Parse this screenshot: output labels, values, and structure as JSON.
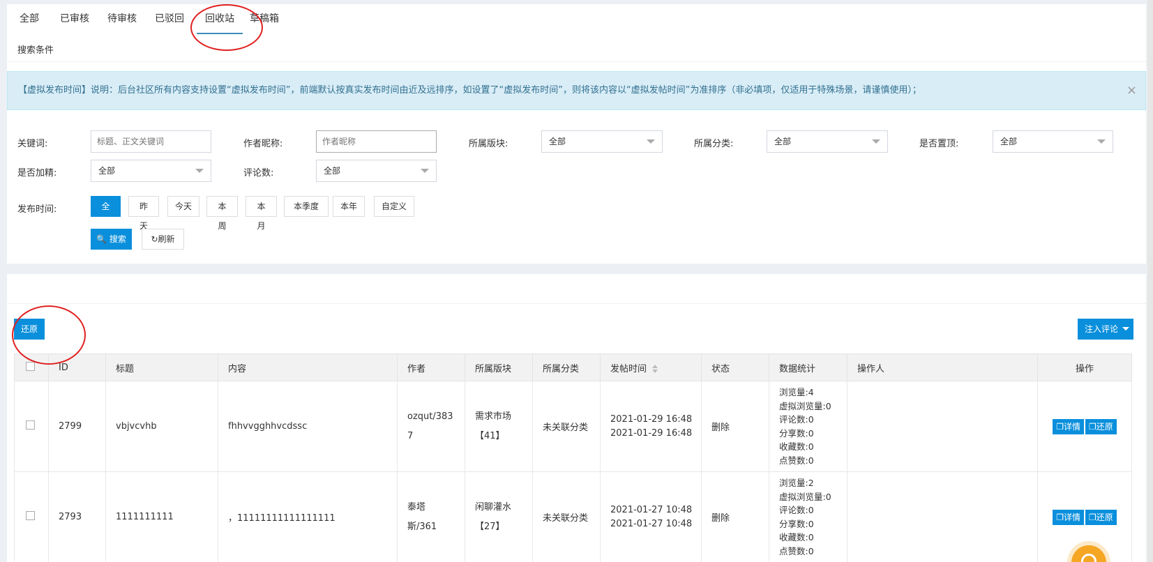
{
  "tabs": [
    {
      "label": "全部"
    },
    {
      "label": "已审核"
    },
    {
      "label": "待审核"
    },
    {
      "label": "已驳回"
    },
    {
      "label": "回收站"
    },
    {
      "label": "草稿箱"
    }
  ],
  "search_title": "搜索条件",
  "alert": {
    "text": "【虚拟发布时间】说明：后台社区所有内容支持设置“虚拟发布时间”，前端默认按真实发布时间由近及远排序，如设置了“虚拟发布时间”，则将该内容以“虚拟发帖时间”为准排序（非必填项，仅适用于特殊场景，请谨慎使用）；",
    "close": "×"
  },
  "filters": {
    "keyword_label": "关键词:",
    "keyword_placeholder": "标题、正文关键词",
    "author_label": "作者昵称:",
    "author_placeholder": "作者昵称",
    "board_label": "所属版块:",
    "board_value": "全部",
    "category_label": "所属分类:",
    "category_value": "全部",
    "top_label": "是否置顶:",
    "top_value": "全部",
    "featured_label": "是否加精:",
    "featured_value": "全部",
    "comments_label": "评论数:",
    "comments_value": "全部",
    "time_label": "发布时间:",
    "time_options": [
      "全部",
      "昨天",
      "今天",
      "本周",
      "本月",
      "本季度",
      "本年",
      "自定义"
    ]
  },
  "actions": {
    "search": "搜索",
    "refresh": "刷新",
    "restore": "还原",
    "inject": "注入评论"
  },
  "table": {
    "headers": [
      "ID",
      "标题",
      "内容",
      "作者",
      "所属版块",
      "所属分类",
      "发帖时间",
      "状态",
      "数据统计",
      "操作人",
      "操作"
    ],
    "rows": [
      {
        "id": "2799",
        "title": "vbjvcvhb",
        "content": "fhhvvgghhvcdssc",
        "author_l1": "ozqut/383",
        "author_l2": "7",
        "board_l1": "需求市场",
        "board_l2": "【41】",
        "category": "未关联分类",
        "time1": "2021-01-29 16:48",
        "time2": "2021-01-29 16:48",
        "status": "删除",
        "stats": [
          "浏览量:4",
          "虚拟浏览量:0",
          "评论数:0",
          "分享数:0",
          "收藏数:0",
          "点赞数:0"
        ],
        "operator": "",
        "op_detail": "详情",
        "op_restore": "还原"
      },
      {
        "id": "2793",
        "title": "1111111111",
        "content": "，11111111111111111",
        "author_l1": "泰塔",
        "author_l2": "斯/361",
        "board_l1": "闲聊灌水",
        "board_l2": "【27】",
        "category": "未关联分类",
        "time1": "2021-01-27 10:48",
        "time2": "2021-01-27 10:48",
        "status": "删除",
        "stats": [
          "浏览量:2",
          "虚拟浏览量:0",
          "评论数:0",
          "分享数:0",
          "收藏数:0",
          "点赞数:0"
        ],
        "operator": "",
        "op_detail": "详情",
        "op_restore": "还原"
      }
    ]
  },
  "colors": {
    "primary": "#0a8fdc",
    "alert_bg": "#d9edf7",
    "annotation": "#e02020"
  }
}
